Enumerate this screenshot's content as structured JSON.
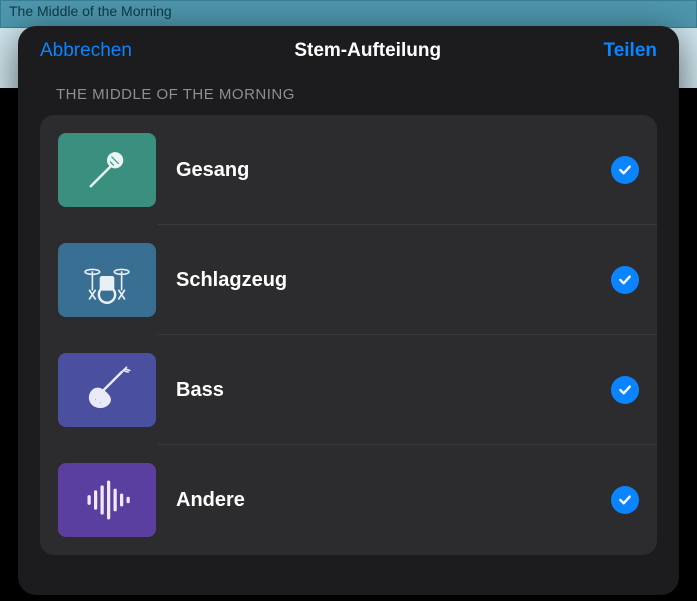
{
  "background_track_title": "The Middle of the Morning",
  "sheet": {
    "cancel_label": "Abbrechen",
    "title": "Stem-Aufteilung",
    "share_label": "Teilen",
    "section_header": "THE MIDDLE OF THE MORNING",
    "stems": [
      {
        "label": "Gesang",
        "icon": "microphone-icon",
        "tile_color": "#3a8f7e",
        "checked": true
      },
      {
        "label": "Schlagzeug",
        "icon": "drums-icon",
        "tile_color": "#3a6f94",
        "checked": true
      },
      {
        "label": "Bass",
        "icon": "bass-guitar-icon",
        "tile_color": "#4a4fa0",
        "checked": true
      },
      {
        "label": "Andere",
        "icon": "waveform-icon",
        "tile_color": "#5b3fa0",
        "checked": true
      }
    ]
  },
  "colors": {
    "accent": "#0a84ff"
  }
}
